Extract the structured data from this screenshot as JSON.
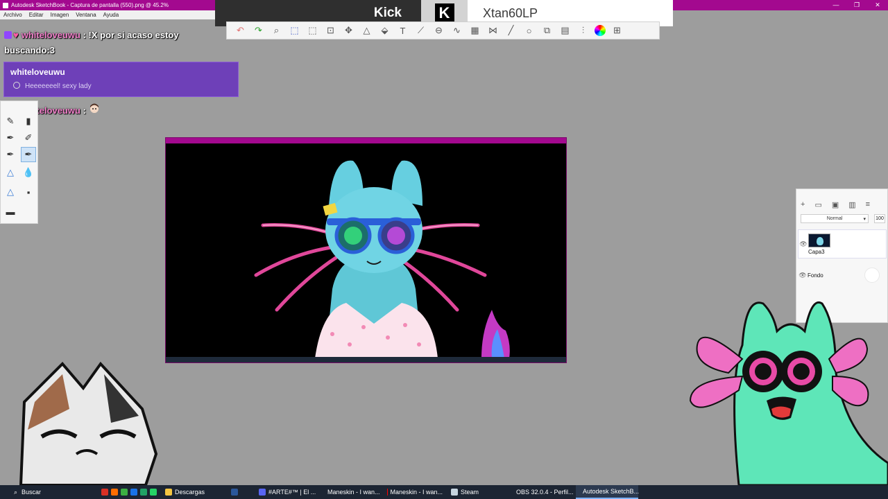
{
  "window": {
    "title": "Autodesk SketchBook - Captura de pantalla (550).png @ 45.2%",
    "controls": [
      "—",
      "❐",
      "✕"
    ]
  },
  "menu": [
    "Archivo",
    "Editar",
    "Imagen",
    "Ventana",
    "Ayuda"
  ],
  "kick": {
    "brand": "Kick",
    "logo_letter": "K",
    "username": "Xtan60LP"
  },
  "chat": {
    "msg1": {
      "user": "whiteloveuwu",
      "sep": ":",
      "text": "!X por si acaso estoy",
      "text2": "buscando:3"
    },
    "highlight": {
      "user": "whiteloveuwu",
      "text": "Heeeeeeel! sexy lady"
    },
    "msg2": {
      "user": "whiteloveuwu",
      "sep": ":"
    }
  },
  "layers": {
    "blend_mode": "Normal",
    "opacity": "100",
    "items": [
      {
        "name": "Capa3",
        "visible": true,
        "selected": true
      },
      {
        "name": "Fondo",
        "visible": true,
        "selected": false
      }
    ]
  },
  "taskbar": {
    "search_placeholder": "Buscar",
    "items": [
      {
        "label": "Descargas",
        "color": "#f4c542",
        "active": false
      },
      {
        "label": "#ARTE#™ | El ...",
        "color": "#5865f2",
        "active": false
      },
      {
        "label": "Maneskin - I wan...",
        "color": "#1a73e8",
        "active": false
      },
      {
        "label": "Maneskin - I wan...",
        "color": "#ff0000",
        "active": false
      },
      {
        "label": "Steam",
        "color": "#1b2838",
        "active": false
      },
      {
        "label": "OBS 32.0.4 - Perfil...",
        "color": "#444444",
        "active": false
      },
      {
        "label": "Autodesk SketchB...",
        "color": "#a3098f",
        "active": true
      }
    ]
  },
  "colors": {
    "titlebar": "#a3098f",
    "chat_highlight": "#6e40b8",
    "chat_username": "#f07fc9",
    "canvas_bg": "#000000"
  }
}
